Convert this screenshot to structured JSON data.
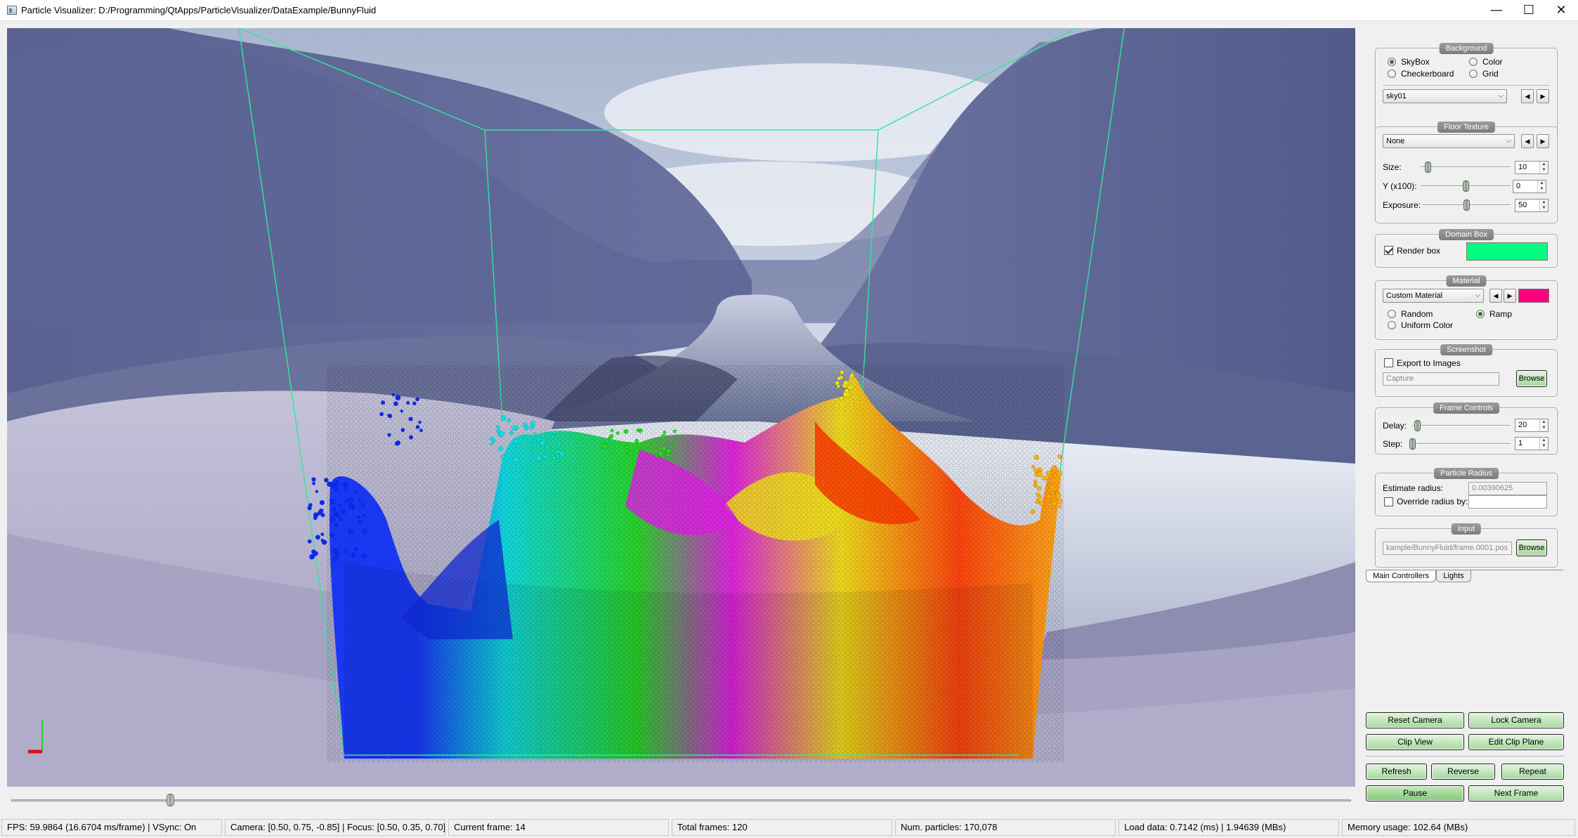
{
  "window": {
    "title": "Particle Visualizer: D:/Programming/QtApps/ParticleVisualizer/DataExample/BunnyFluid",
    "minimize_glyph": "—",
    "maximize_glyph": "☐",
    "close_glyph": "✕"
  },
  "scene": {
    "sky_colors": [
      "#d9e0ec",
      "#b8c3d8",
      "#7e87a8"
    ],
    "mountain_color": "#5e6690",
    "river_color": "#8a96b2",
    "snow_color": "#b6b3cc",
    "domain_box_color": "#00ff80",
    "particle_ramp": [
      "#0a2aff",
      "#00e5e5",
      "#1fdc1f",
      "#e020e8",
      "#f2e21a",
      "#ff3a00",
      "#ffb000"
    ],
    "axes": [
      "x-axis",
      "y-axis"
    ]
  },
  "timeline": {
    "current_frame": 14,
    "total_frames": 120
  },
  "status": {
    "fps": "FPS: 59.9864 (16.6704 ms/frame) | VSync: On",
    "camera": "Camera: [0.50, 0.75, -0.85] | Focus: [0.50, 0.35, 0.70]",
    "current_frame": "Current frame: 14",
    "total_frames": "Total frames: 120",
    "num_particles": "Num. particles: 170,078",
    "load_data": "Load data: 0.7142 (ms) | 1.94639 (MBs)",
    "memory": "Memory usage: 102.64 (MBs)"
  },
  "panel": {
    "background": {
      "title": "Background",
      "options": [
        "SkyBox",
        "Color",
        "Checkerboard",
        "Grid"
      ],
      "selected": "SkyBox",
      "texture": "sky01"
    },
    "floor": {
      "title": "Floor Texture",
      "texture": "None",
      "size_label": "Size:",
      "size": "10",
      "size_level": 0.05,
      "y_label": "Y (x100):",
      "y": "0",
      "y_level": 0.5,
      "exposure_label": "Exposure:",
      "exposure": "50",
      "exposure_level": 0.5
    },
    "domain_box": {
      "title": "Domain Box",
      "render_label": "Render box",
      "render_checked": true,
      "color": "#00ff80"
    },
    "material": {
      "title": "Material",
      "preset": "Custom Material",
      "color": "#ff0080",
      "options": [
        "Random",
        "Ramp",
        "Uniform Color"
      ],
      "selected": "Ramp"
    },
    "screenshot": {
      "title": "Screenshot",
      "export_label": "Export to Images",
      "export_checked": false,
      "capture_placeholder": "Capture",
      "browse_label": "Browse"
    },
    "frame_controls": {
      "title": "Frame Controls",
      "delay_label": "Delay:",
      "delay": "20",
      "delay_level": 0.02,
      "step_label": "Step:",
      "step": "1",
      "step_level": 0.0
    },
    "particle_radius": {
      "title": "Particle Radius",
      "estimate_label": "Estimate radius:",
      "estimate_value": "0.00390625",
      "override_label": "Override radius by:",
      "override_checked": false
    },
    "input": {
      "title": "Input",
      "path": "kample/BunnyFluid/frame.0001.pos",
      "browse_label": "Browse"
    },
    "tabs": [
      "Main Controllers",
      "Lights"
    ],
    "active_tab": "Main Controllers"
  },
  "buttons": {
    "reset_camera": "Reset Camera",
    "lock_camera": "Lock Camera",
    "clip_view": "Clip View",
    "edit_clip_plane": "Edit Clip Plane",
    "refresh": "Refresh",
    "reverse": "Reverse",
    "repeat": "Repeat",
    "pause": "Pause",
    "next_frame": "Next Frame"
  }
}
